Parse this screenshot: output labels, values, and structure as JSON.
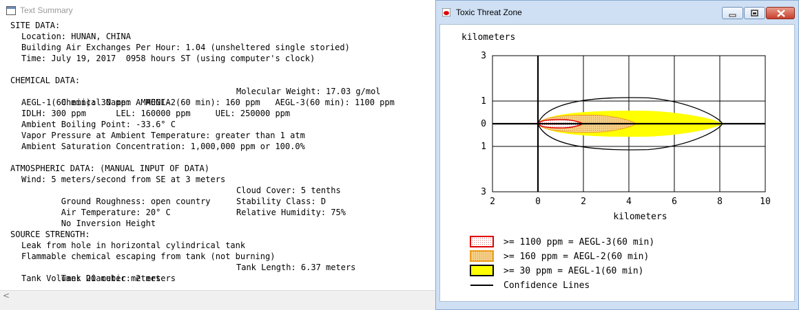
{
  "text_summary": {
    "title": "Text Summary",
    "site": {
      "heading": "SITE DATA:",
      "location": "Location: HUNAN, CHINA",
      "air_exchanges": "Building Air Exchanges Per Hour: 1.04 (unsheltered single storied)",
      "time": "Time: July 19, 2017  0958 hours ST (using computer's clock)"
    },
    "chemical": {
      "heading": "CHEMICAL DATA:",
      "name": "Chemical Name: AMMONIA",
      "molecular_weight": "Molecular Weight: 17.03 g/mol",
      "aegl": "AEGL-1(60 min): 30 ppm   AEGL-2(60 min): 160 ppm   AEGL-3(60 min): 1100 ppm",
      "idlh_lel_uel": "IDLH: 300 ppm      LEL: 160000 ppm     UEL: 250000 ppm",
      "boiling_point": "Ambient Boiling Point: -33.6° C",
      "vapor_pressure": "Vapor Pressure at Ambient Temperature: greater than 1 atm",
      "saturation": "Ambient Saturation Concentration: 1,000,000 ppm or 100.0%"
    },
    "atmospheric": {
      "heading": "ATMOSPHERIC DATA: (MANUAL INPUT OF DATA)",
      "wind": "Wind: 5 meters/second from SE at 3 meters",
      "roughness": "Ground Roughness: open country",
      "cloud_cover": "Cloud Cover: 5 tenths",
      "air_temp": "Air Temperature: 20° C",
      "stability": "Stability Class: D",
      "inversion": "No Inversion Height",
      "humidity": "Relative Humidity: 75%"
    },
    "source": {
      "heading": "SOURCE STRENGTH:",
      "leak": "Leak from hole in horizontal cylindrical tank",
      "flammable": "Flammable chemical escaping from tank (not burning)",
      "tank_diameter": "Tank Diameter: 2 meters",
      "tank_length": "Tank Length: 6.37 meters",
      "tank_volume": "Tank Volume: 20 cubic meters"
    },
    "scroll_left_glyph": "<"
  },
  "threat_zone": {
    "title": "Toxic Threat Zone",
    "buttons": {
      "minimize": "minimize",
      "maximize": "maximize",
      "close": "close"
    },
    "colors": {
      "aegl3_border": "#e00000",
      "aegl2_fill": "#f5d08a",
      "aegl2_border": "#f0a020",
      "aegl1_fill": "#ffff00",
      "confidence": "#000000"
    },
    "chart_data": {
      "type": "threat-zone-footprint",
      "y_axis_label": "kilometers",
      "x_axis_label": "kilometers",
      "x_ticks": [
        "2",
        "0",
        "2",
        "4",
        "6",
        "8",
        "10"
      ],
      "y_ticks": [
        "3",
        "1",
        "0",
        "1",
        "3"
      ],
      "xlim": [
        -2,
        10
      ],
      "ylim": [
        -3,
        3
      ],
      "grid": true,
      "zones": [
        {
          "label": ">= 1100 ppm = AEGL-3(60 min)",
          "extent_km": 1.95,
          "half_width_km": 0.12,
          "style": "red dotted outline"
        },
        {
          "label": ">= 160 ppm = AEGL-2(60 min)",
          "extent_km": 4.3,
          "half_width_km": 0.4,
          "style": "orange stippled fill"
        },
        {
          "label": ">= 30 ppm = AEGL-1(60 min)",
          "extent_km": 8.1,
          "half_width_km": 0.6,
          "style": "yellow fill"
        }
      ],
      "confidence_lines": {
        "label": "Confidence Lines",
        "extent_km": 8.1,
        "half_width_km": 1.2
      }
    }
  }
}
